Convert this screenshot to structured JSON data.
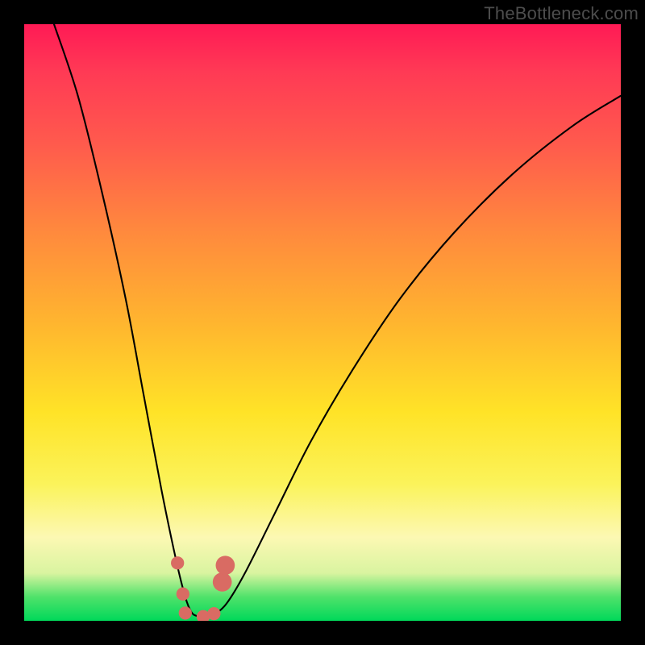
{
  "watermark": "TheBottleneck.com",
  "chart_data": {
    "type": "line",
    "title": "",
    "xlabel": "",
    "ylabel": "",
    "xlim": [
      0,
      100
    ],
    "ylim": [
      0,
      100
    ],
    "background_gradient": {
      "top_color": "#ff1a55",
      "bottom_color": "#00d85a",
      "meaning": "red=high bottleneck, green=low bottleneck"
    },
    "series": [
      {
        "name": "bottleneck-curve",
        "x": [
          5,
          9,
          13,
          17,
          20,
          23,
          25.5,
          27,
          28,
          29,
          30.5,
          32,
          34,
          37,
          42,
          48,
          55,
          63,
          72,
          82,
          92,
          100
        ],
        "y": [
          100,
          88,
          72,
          54,
          38,
          22,
          10,
          4,
          1.5,
          0.8,
          0.8,
          1.2,
          3,
          8,
          18,
          30,
          42,
          54,
          65,
          75,
          83,
          88
        ]
      }
    ],
    "markers": [
      {
        "name": "marker-1",
        "x": 25.7,
        "y": 9.7,
        "r": 1.1
      },
      {
        "name": "marker-2",
        "x": 26.6,
        "y": 4.5,
        "r": 1.1
      },
      {
        "name": "marker-3",
        "x": 27.0,
        "y": 1.3,
        "r": 1.1
      },
      {
        "name": "marker-4",
        "x": 30.0,
        "y": 0.7,
        "r": 1.1
      },
      {
        "name": "marker-5",
        "x": 31.8,
        "y": 1.2,
        "r": 1.1
      },
      {
        "name": "marker-6",
        "x": 33.2,
        "y": 6.5,
        "r": 1.6
      },
      {
        "name": "marker-7",
        "x": 33.7,
        "y": 9.3,
        "r": 1.6
      }
    ],
    "marker_color": "#d96b63"
  }
}
